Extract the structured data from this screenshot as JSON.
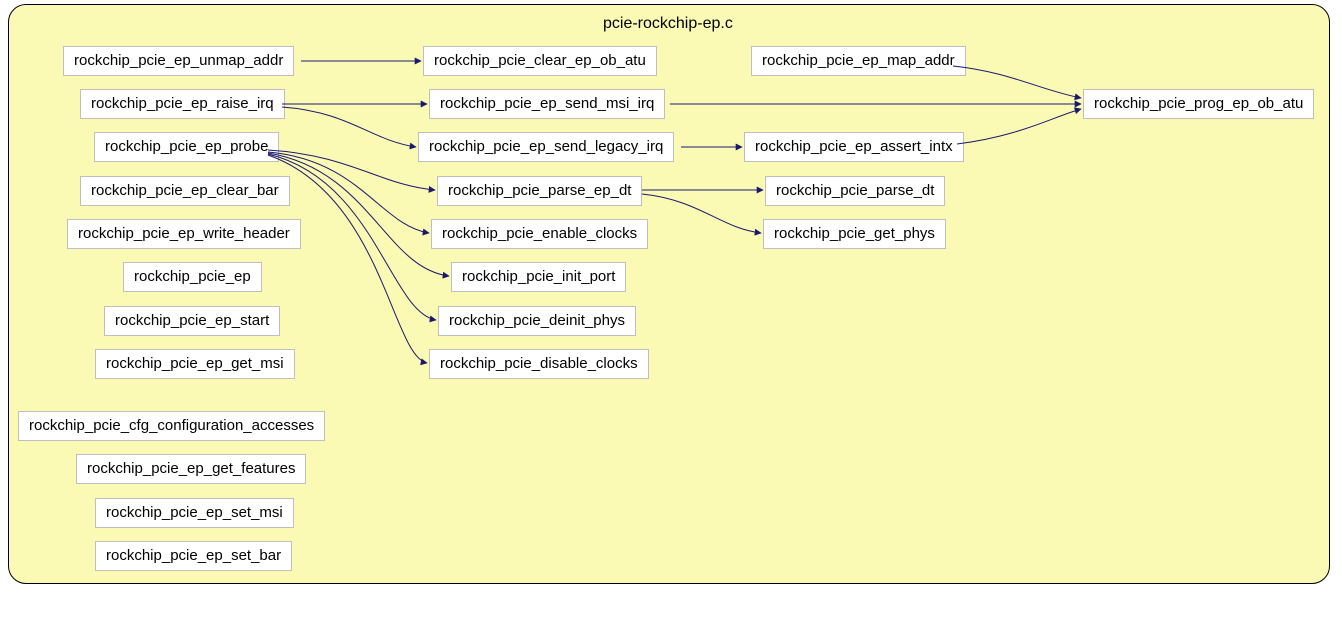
{
  "module": {
    "title": "pcie-rockchip-ep.c"
  },
  "nodes": {
    "n_unmap_addr": {
      "label": "rockchip_pcie_ep_unmap_addr"
    },
    "n_clear_ob_atu": {
      "label": "rockchip_pcie_clear_ep_ob_atu"
    },
    "n_map_addr": {
      "label": "rockchip_pcie_ep_map_addr"
    },
    "n_prog_ob_atu": {
      "label": "rockchip_pcie_prog_ep_ob_atu"
    },
    "n_raise_irq": {
      "label": "rockchip_pcie_ep_raise_irq"
    },
    "n_send_msi": {
      "label": "rockchip_pcie_ep_send_msi_irq"
    },
    "n_probe": {
      "label": "rockchip_pcie_ep_probe"
    },
    "n_send_legacy": {
      "label": "rockchip_pcie_ep_send_legacy_irq"
    },
    "n_assert_intx": {
      "label": "rockchip_pcie_ep_assert_intx"
    },
    "n_clear_bar": {
      "label": "rockchip_pcie_ep_clear_bar"
    },
    "n_parse_ep_dt": {
      "label": "rockchip_pcie_parse_ep_dt"
    },
    "n_parse_dt": {
      "label": "rockchip_pcie_parse_dt"
    },
    "n_write_header": {
      "label": "rockchip_pcie_ep_write_header"
    },
    "n_enable_clocks": {
      "label": "rockchip_pcie_enable_clocks"
    },
    "n_get_phys": {
      "label": "rockchip_pcie_get_phys"
    },
    "n_ep": {
      "label": "rockchip_pcie_ep"
    },
    "n_init_port": {
      "label": "rockchip_pcie_init_port"
    },
    "n_ep_start": {
      "label": "rockchip_pcie_ep_start"
    },
    "n_deinit_phys": {
      "label": "rockchip_pcie_deinit_phys"
    },
    "n_ep_get_msi": {
      "label": "rockchip_pcie_ep_get_msi"
    },
    "n_disable_clocks": {
      "label": "rockchip_pcie_disable_clocks"
    },
    "n_cfg_accesses": {
      "label": "rockchip_pcie_cfg_configuration_accesses"
    },
    "n_get_features": {
      "label": "rockchip_pcie_ep_get_features"
    },
    "n_set_msi": {
      "label": "rockchip_pcie_ep_set_msi"
    },
    "n_set_bar": {
      "label": "rockchip_pcie_ep_set_bar"
    }
  }
}
